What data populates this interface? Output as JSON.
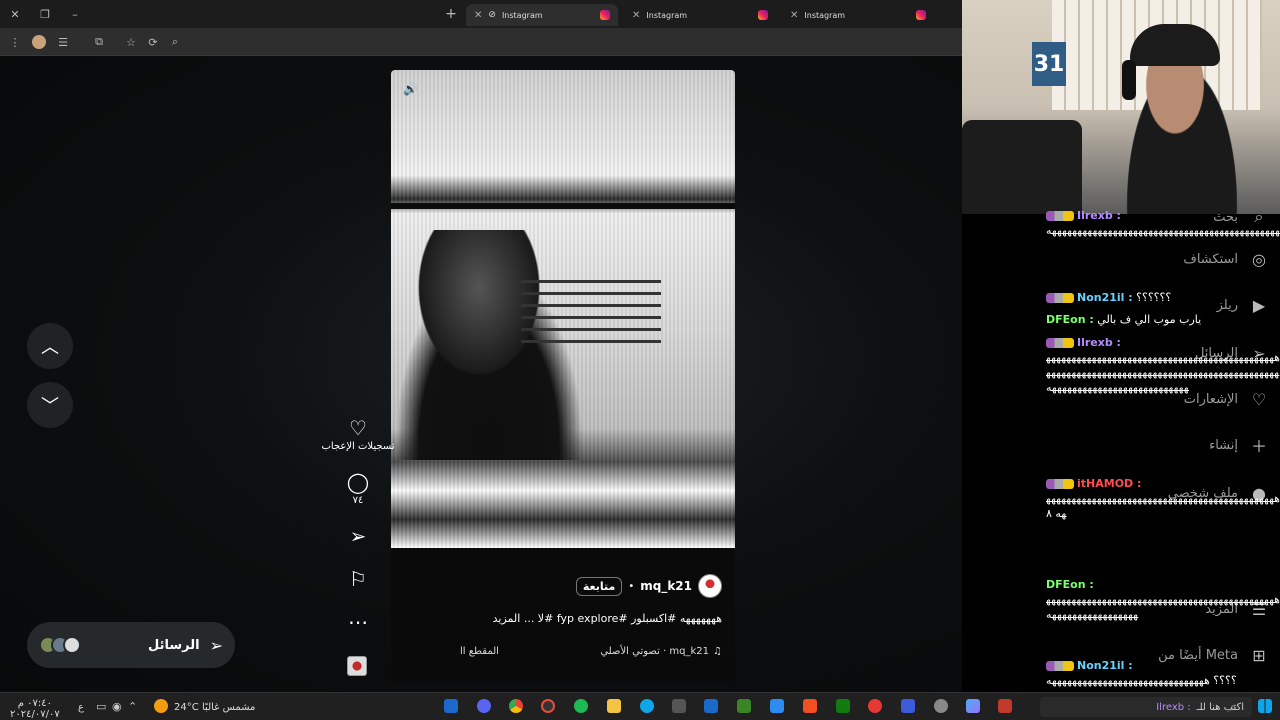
{
  "browser": {
    "tabs": [
      {
        "label": "Instagram",
        "active": true
      },
      {
        "label": "Instagram",
        "active": false
      },
      {
        "label": "Instagram",
        "active": false
      }
    ],
    "new_tab_label": "+",
    "window_icons": [
      "close-icon",
      "restore-icon",
      "minimize-icon"
    ],
    "toolbar_icons": [
      "menu-icon",
      "profile-icon",
      "equalizer-icon",
      "extensions-icon",
      "star-icon",
      "refresh-icon",
      "search-icon"
    ]
  },
  "reel": {
    "actions": {
      "like_label": "تسجيلات الإعجاب",
      "comments_count": "٧٤"
    },
    "username": "mq_k21",
    "dot": "•",
    "follow_label": "متابعة",
    "caption": "هههههههه #اكسبلور #fyp explore #لا ... المزيد",
    "audio": "تصوتي الأصلي · mq_k21",
    "pause_label": "المقطع اا"
  },
  "messages_bar": {
    "label": "الرسائل"
  },
  "sidebar": {
    "items": [
      {
        "label": "بحث",
        "icon": "search-icon"
      },
      {
        "label": "استكشاف",
        "icon": "compass-icon"
      },
      {
        "label": "ريلز",
        "icon": "reels-icon"
      },
      {
        "label": "الرسائل",
        "icon": "send-icon"
      },
      {
        "label": "الإشعارات",
        "icon": "heart-icon"
      },
      {
        "label": "إنشاء",
        "icon": "plus-icon"
      },
      {
        "label": "ملف شخصي",
        "icon": "avatar-icon"
      },
      {
        "label": "المزيد",
        "icon": "menu-icon"
      },
      {
        "label": "أيضًا من Meta",
        "icon": "grid-icon"
      }
    ]
  },
  "chat": {
    "messages": [
      {
        "user": "Ilrexb :",
        "color": "#b48cff",
        "text": "ههههههههههههههههههههههههههههههههههههههههههههههههههههههههههههههههههههههههه"
      },
      {
        "user": "Non21il :",
        "color": "#6ad1ff",
        "text": "؟؟؟؟؟؟"
      },
      {
        "user": "DFEon :",
        "color": "#7cff6b",
        "text": "يارب موب الي ف بالي"
      },
      {
        "user": "Ilrexb :",
        "color": "#b48cff",
        "text": "هههههههههههههههههههههههههههههههههههههههههههههههههههههههههههههههههههههههههههههههههههههههههههههههههههههههههههههههههههههههه"
      },
      {
        "user": "itHAMOD :",
        "color": "#ff4d4d",
        "text": "هههههههههههههههههههههههههههههههههههههههههههههههه ٨"
      },
      {
        "user": "DFEon :",
        "color": "#7cff6b",
        "text": "هههههههههههههههههههههههههههههههههههههههههههههههههههههههههههههههه"
      },
      {
        "user": "Non21il :",
        "color": "#6ad1ff",
        "text": "؟؟؟؟ هههههههههههههههههههههههههههههههه"
      }
    ],
    "input_placeholder": "اكتب هنا للـ",
    "last_user": "Ilrexb :"
  },
  "webcam": {
    "poster_number": "31"
  },
  "taskbar": {
    "weather_temp": "24°C",
    "weather_text": "مشمس غالبًا",
    "time": "٠٧:٤٠ م",
    "date": "٢٠٢٤/٠٧/٠٧",
    "lang": "ع"
  }
}
